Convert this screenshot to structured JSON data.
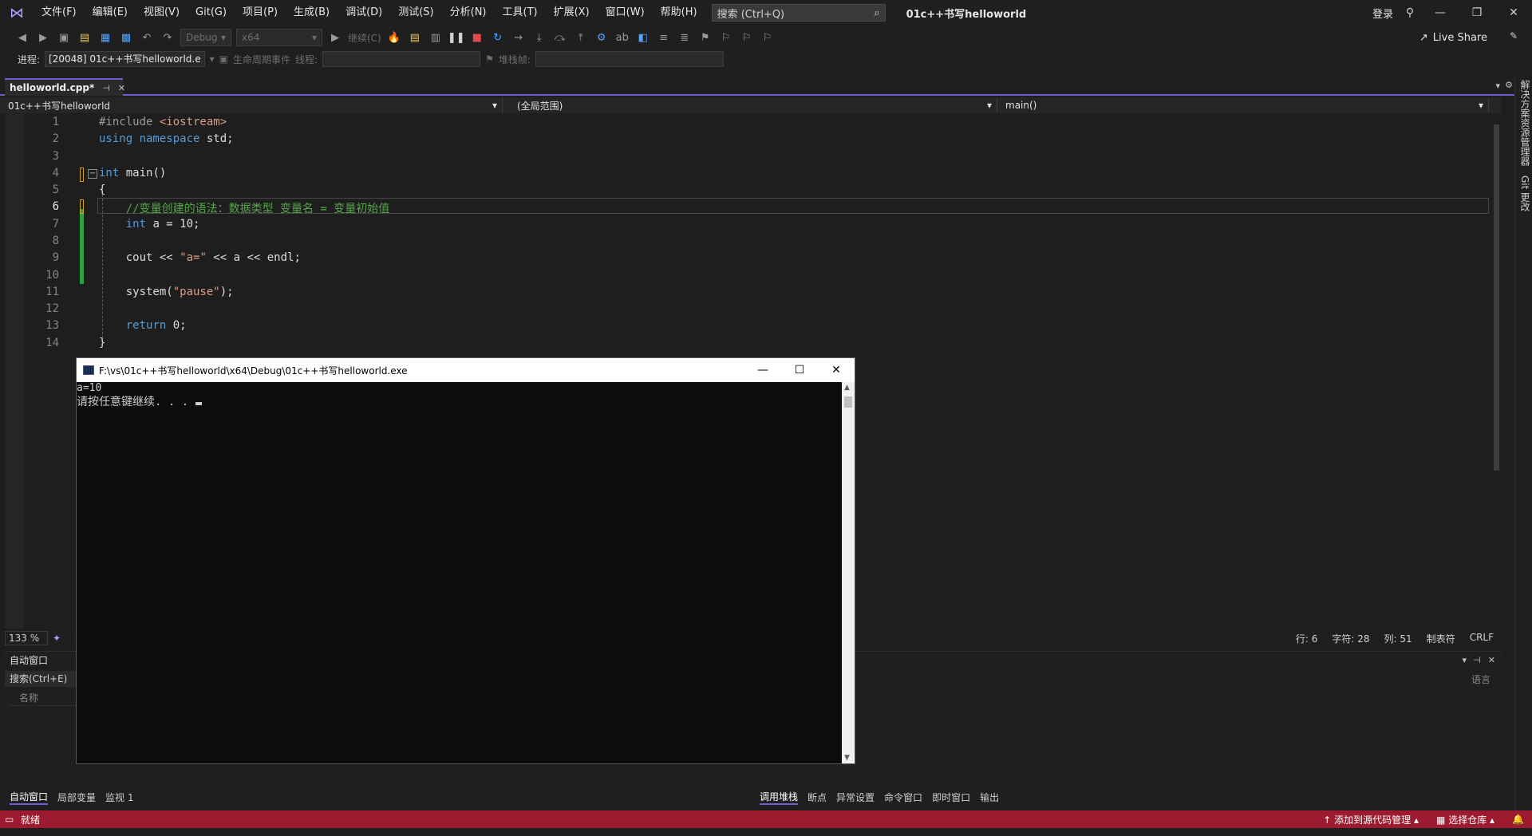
{
  "menu": {
    "items": [
      "文件(F)",
      "编辑(E)",
      "视图(V)",
      "Git(G)",
      "项目(P)",
      "生成(B)",
      "调试(D)",
      "测试(S)",
      "分析(N)",
      "工具(T)",
      "扩展(X)",
      "窗口(W)",
      "帮助(H)"
    ],
    "search_placeholder": "搜索 (Ctrl+Q)",
    "window_title": "01c++书写helloworld",
    "login": "登录"
  },
  "toolbar": {
    "config": "Debug",
    "platform": "x64",
    "continue_label": "继续(C)",
    "live_share": "Live Share"
  },
  "processbar": {
    "process_label": "进程:",
    "process_value": "[20048] 01c++书写helloworld.e",
    "lifecycle_label": "生命周期事件",
    "thread_label": "线程:",
    "stack_label": "堆栈帧:"
  },
  "doc_tab": {
    "filename": "helloworld.cpp*"
  },
  "navbar": {
    "project": "01c++书写helloworld",
    "scope": "(全局范围)",
    "function": "main()"
  },
  "editor": {
    "line_numbers": [
      "1",
      "2",
      "3",
      "4",
      "5",
      "6",
      "7",
      "8",
      "9",
      "10",
      "11",
      "12",
      "13",
      "14"
    ],
    "zoom": "133 %",
    "line_info": "行: 6",
    "char_info": "字符: 28",
    "col_info": "列: 51",
    "tab_info": "制表符",
    "eol_info": "CRLF"
  },
  "right_strip": {
    "solution_explorer": "解决方案资源管理器",
    "git_changes": "Git 更改"
  },
  "auto_window": {
    "title": "自动窗口",
    "search": "搜索(Ctrl+E)",
    "col_name": "名称",
    "col_lang": "语言"
  },
  "bottom_tabs_left": [
    "自动窗口",
    "局部变量",
    "监视 1"
  ],
  "bottom_tabs_right": [
    "调用堆栈",
    "断点",
    "异常设置",
    "命令窗口",
    "即时窗口",
    "输出"
  ],
  "statusbar": {
    "ready": "就绪",
    "add_source_control": "添加到源代码管理",
    "select_repo": "选择仓库"
  },
  "console": {
    "path": "F:\\vs\\01c++书写helloworld\\x64\\Debug\\01c++书写helloworld.exe",
    "output_line1": "a=10",
    "output_line2": "请按任意键继续. . ."
  },
  "colors": {
    "accent": "#6c5fd6",
    "statusbar": "#9c1b2e",
    "keyword": "#569cd6",
    "comment": "#57a64a",
    "string": "#d69d85"
  }
}
